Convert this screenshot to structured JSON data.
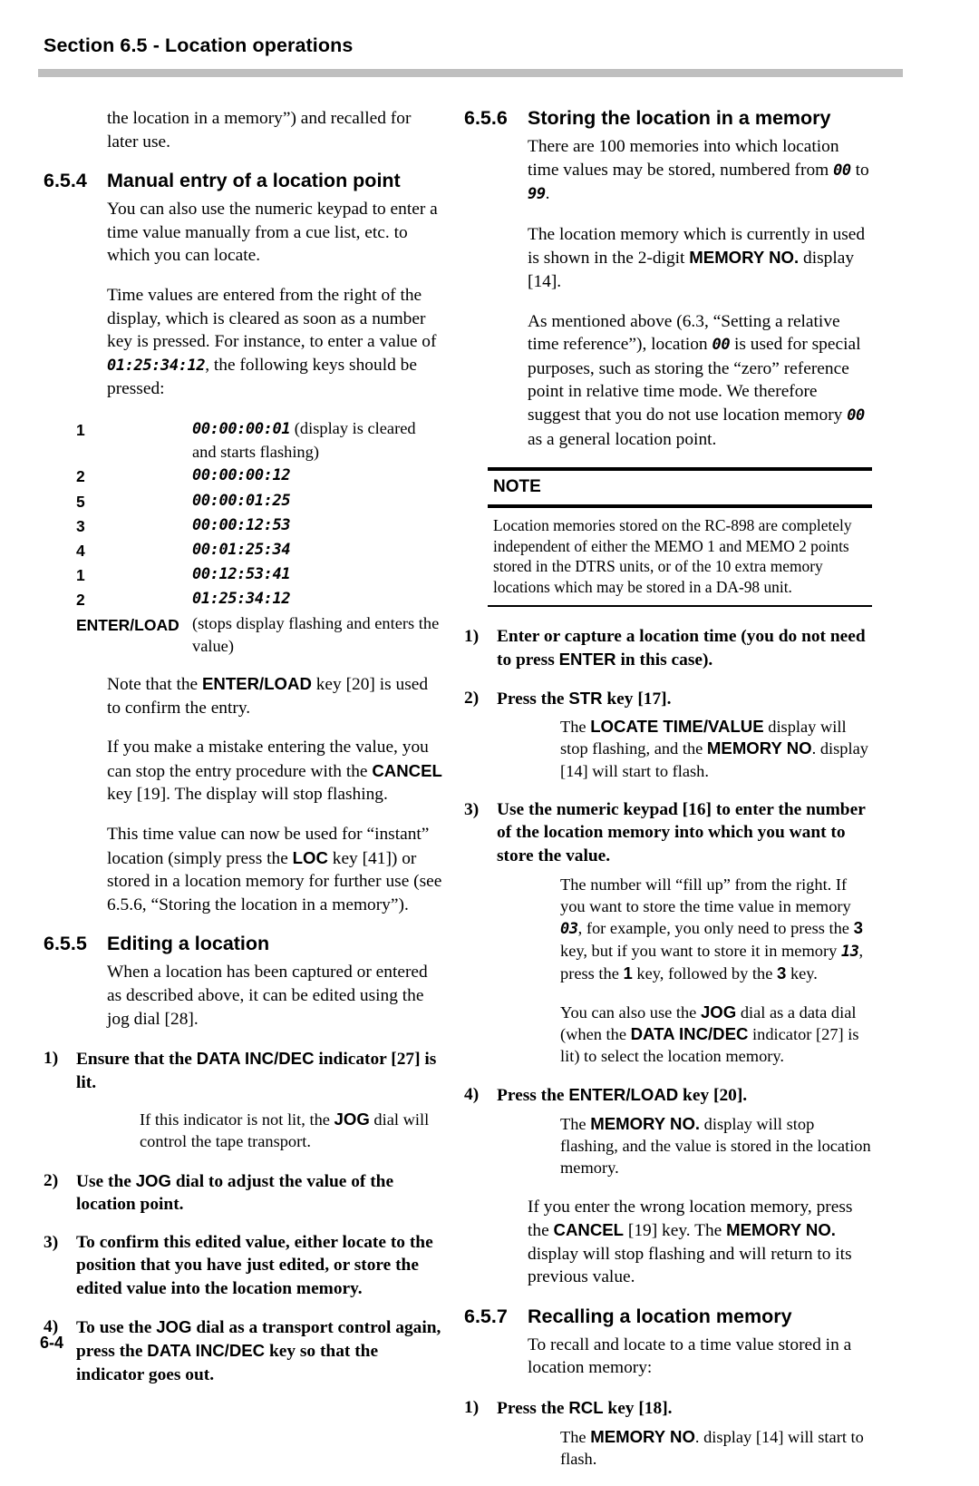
{
  "header": {
    "running_head": "Section 6.5 - Location operations"
  },
  "footer": {
    "page_number": "6-4"
  },
  "left_column": {
    "carryover_paragraph": "the location in a memory”) and recalled for later use.",
    "section_654": {
      "number": "6.5.4",
      "title": "Manual entry of a location point",
      "p1": "You can also use the numeric keypad to enter a time value manually from a cue list, etc. to which you can locate.",
      "p2_a": "Time values are entered from the right of the display, which is cleared as soon as a number key is pressed. For instance, to enter a value of ",
      "p2_value": "01:25:34:12",
      "p2_b": ", the following keys should be pressed:",
      "key_table": [
        {
          "key": "1",
          "value": "00:00:00:01",
          "note": " (display is cleared and starts flashing)"
        },
        {
          "key": "2",
          "value": "00:00:00:12",
          "note": ""
        },
        {
          "key": "5",
          "value": "00:00:01:25",
          "note": ""
        },
        {
          "key": "3",
          "value": "00:00:12:53",
          "note": ""
        },
        {
          "key": "4",
          "value": "00:01:25:34",
          "note": ""
        },
        {
          "key": "1",
          "value": "00:12:53:41",
          "note": ""
        },
        {
          "key": "2",
          "value": "01:25:34:12",
          "note": ""
        },
        {
          "key": "ENTER/LOAD",
          "value": "",
          "note": "(stops display flashing and enters the value)"
        }
      ],
      "p3_a": "Note that the ",
      "p3_key": "ENTER/LOAD",
      "p3_b": " key [20] is used to confirm the entry.",
      "p4_a": "If you make a mistake entering the value, you can stop the entry procedure with the ",
      "p4_key": "CANCEL",
      "p4_b": " key [19]. The display will stop flashing.",
      "p5_a": "This time value can now be used for “instant” location (simply press the ",
      "p5_key": "LOC",
      "p5_b": " key [41]) or stored in a location memory for further use (see 6.5.6, “Storing the location in a memory”)."
    },
    "section_655": {
      "number": "6.5.5",
      "title": "Editing a location",
      "p1": "When a location has been captured or entered as described above, it can be edited using the jog dial [28].",
      "steps": [
        {
          "number": "1)",
          "text_a": "Ensure that the ",
          "key": "DATA INC/DEC",
          "text_b": " indicator [27] is lit.",
          "sub_a": "If this indicator is not lit, the ",
          "sub_key": "JOG",
          "sub_b": " dial will control the tape transport."
        },
        {
          "number": "2)",
          "text_a": "Use the ",
          "key": "JOG",
          "text_b": " dial to adjust the value of the location point.",
          "sub_a": "",
          "sub_key": "",
          "sub_b": ""
        },
        {
          "number": "3)",
          "text_a": "To confirm this edited value, either locate to the position that you have just edited, or store the edited value into the location memory.",
          "key": "",
          "text_b": "",
          "sub_a": "",
          "sub_key": "",
          "sub_b": ""
        },
        {
          "number": "4)",
          "text_a": "To use the ",
          "key": "JOG",
          "text_b": " dial as a transport control again, press the ",
          "key2": "DATA INC/DEC",
          "text_c": " key so that the indicator goes out.",
          "sub_a": "",
          "sub_key": "",
          "sub_b": ""
        }
      ]
    }
  },
  "right_column": {
    "section_656": {
      "number": "6.5.6",
      "title": "Storing the location in a memory",
      "p1_a": "There are 100 memories into which location time values may be stored, numbered from ",
      "p1_v1": "00",
      "p1_b": " to ",
      "p1_v2": "99",
      "p1_c": ".",
      "p2_a": "The location memory which is currently in used is shown in the 2-digit ",
      "p2_key": "MEMORY NO.",
      "p2_b": " display [14].",
      "p3_a": "As mentioned above (6.3, “Setting a relative time reference”), location ",
      "p3_v1": "00",
      "p3_b": " is used for special purposes, such as storing the “zero” reference point in relative time mode. We therefore suggest that you do not use location memory ",
      "p3_v2": "00",
      "p3_c": " as a general location point.",
      "note": {
        "title": "NOTE",
        "body": "Location memories stored on the RC-898 are completely independent of either the MEMO 1 and MEMO 2 points stored in the DTRS units, or of the 10 extra memory locations which may be stored in a DA-98 unit."
      },
      "steps": [
        {
          "number": "1)",
          "text_a": "Enter or capture a location time (you do not need to press ",
          "key": "ENTER",
          "text_b": " in this case)."
        },
        {
          "number": "2)",
          "text_a": "Press the ",
          "key": "STR",
          "text_b": " key [17].",
          "sub_a": "The ",
          "sub_key": "LOCATE TIME/VALUE",
          "sub_b": " display will stop flashing, and the ",
          "sub_key2": "MEMORY NO",
          "sub_c": ". display [14] will start to flash."
        },
        {
          "number": "3)",
          "text_a": "Use the numeric keypad [16] to enter the number of the location memory into which you want to store the value.",
          "sub_a": "The number will “fill up” from the right. If you want to store the time value in memory ",
          "sub_v1": "03",
          "sub_b": ", for example, you only need to press the ",
          "sub_k1": "3",
          "sub_c": " key, but if you want to store it in memory ",
          "sub_v2": "13",
          "sub_d": ", press the ",
          "sub_k2": "1",
          "sub_e": " key, followed by the ",
          "sub_k3": "3",
          "sub_f": " key."
        }
      ],
      "jog_note_a": "You can also use the ",
      "jog_note_key": "JOG",
      "jog_note_b": " dial as a data dial (when the ",
      "jog_note_key2": "DATA INC/DEC",
      "jog_note_c": " indicator [27] is lit) to select the location memory.",
      "step4": {
        "number": "4)",
        "text_a": "Press the ",
        "key": "ENTER/LOAD",
        "text_b": " key [20].",
        "sub_a": "The ",
        "sub_key": "MEMORY NO.",
        "sub_b": " display will stop flashing, and the value is stored in the location memory."
      },
      "p_cancel_a": "If you enter the wrong location memory, press the ",
      "p_cancel_key": "CANCEL",
      "p_cancel_b": " [19] key. The ",
      "p_cancel_key2": "MEMORY NO.",
      "p_cancel_c": " display will stop flashing and will return to its previous value."
    },
    "section_657": {
      "number": "6.5.7",
      "title": "Recalling a location memory",
      "p1": "To recall and locate to a time value stored in a location memory:",
      "step1": {
        "number": "1)",
        "text_a": "Press the ",
        "key": "RCL",
        "text_b": " key [18].",
        "sub_a": "The ",
        "sub_key": "MEMORY NO",
        "sub_b": ". display [14] will start to flash."
      }
    }
  }
}
